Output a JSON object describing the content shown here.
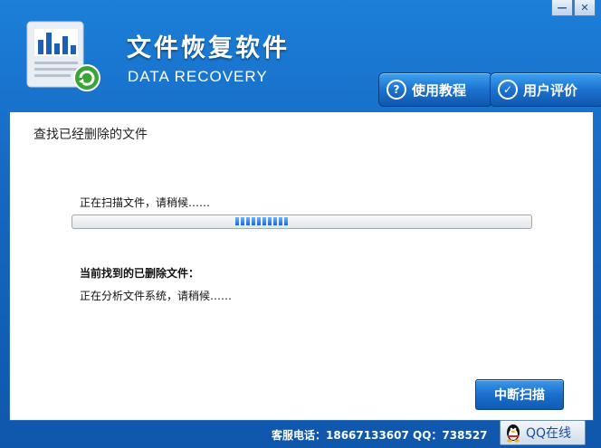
{
  "window": {
    "minimize_label": "—",
    "close_label": "✕"
  },
  "header": {
    "title": "文件恢复软件",
    "subtitle": "DATA RECOVERY",
    "tutorial_label": "使用教程",
    "review_label": "用户评价"
  },
  "main": {
    "section_title": "查找已经删除的文件",
    "scan_status": "正在扫描文件，请稍候……",
    "progress": 0.4,
    "found_title": "当前找到的已删除文件：",
    "analyze_status": "正在分析文件系统，请稍候……",
    "stop_label": "中断扫描"
  },
  "footer": {
    "contact": "客服电话：18667133607 QQ：738527",
    "qq_label": "QQ在线"
  },
  "colors": {
    "accent": "#1668c3",
    "progress_fill": "#1a66d8"
  }
}
